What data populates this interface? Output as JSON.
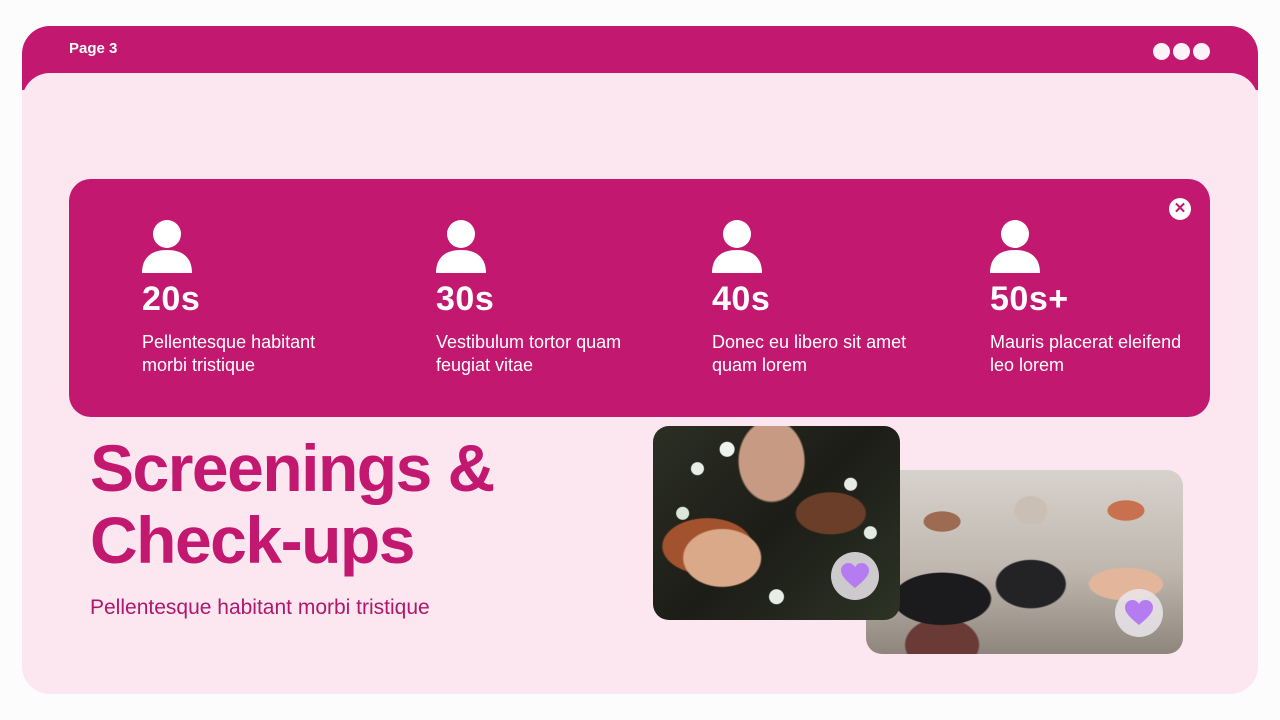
{
  "window": {
    "page_label": "Page 3",
    "menu_dots_icon": "more-dots-icon"
  },
  "stats": {
    "close_icon": "close-icon",
    "items": [
      {
        "icon": "person-icon",
        "age": "20s",
        "desc": "Pellentesque habitant morbi tristique"
      },
      {
        "icon": "person-icon",
        "age": "30s",
        "desc": "Vestibulum tortor quam feugiat vitae"
      },
      {
        "icon": "person-icon",
        "age": "40s",
        "desc": "Donec eu libero sit amet quam lorem"
      },
      {
        "icon": "person-icon",
        "age": "50s+",
        "desc": "Mauris placerat eleifend leo lorem"
      }
    ]
  },
  "main": {
    "heading": "Screenings & Check-ups",
    "subtitle": "Pellentesque habitant morbi tristique"
  },
  "photos": [
    {
      "heart_icon": "heart-icon"
    },
    {
      "heart_icon": "heart-icon"
    }
  ],
  "colors": {
    "accent": "#C2186F",
    "background": "#FCE6EF",
    "heart": "#B57CF2"
  }
}
